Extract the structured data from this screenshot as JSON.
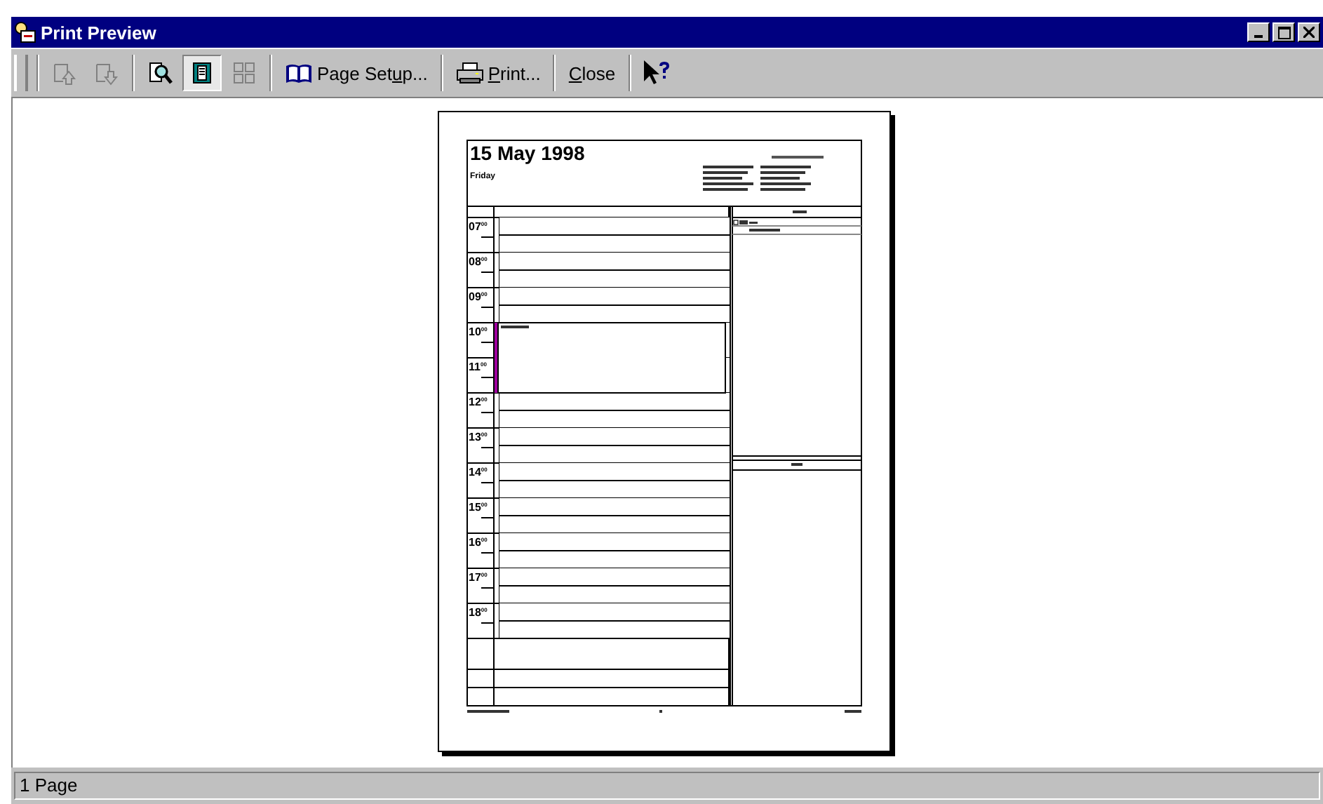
{
  "window": {
    "title": "Print Preview"
  },
  "toolbar": {
    "icon_buttons": [
      {
        "disabled": true,
        "selected": false
      },
      {
        "disabled": true,
        "selected": false
      },
      {
        "disabled": false,
        "selected": false
      },
      {
        "disabled": false,
        "selected": true
      },
      {
        "disabled": true,
        "selected": false
      }
    ],
    "text_buttons": [
      {
        "before": "Page Set",
        "underlined": "u",
        "after": "p..."
      },
      {
        "underlined": "P",
        "after": "rint..."
      },
      {
        "underlined": "C",
        "after": "lose"
      }
    ]
  },
  "page": {
    "date": "15 May 1998",
    "weekday": "Friday",
    "hours": [
      {
        "hour": "07",
        "minutes": "00",
        "booked": false
      },
      {
        "hour": "08",
        "minutes": "00",
        "booked": false
      },
      {
        "hour": "09",
        "minutes": "00",
        "booked": false
      },
      {
        "hour": "10",
        "minutes": "00",
        "booked": true
      },
      {
        "hour": "11",
        "minutes": "00",
        "booked": true
      },
      {
        "hour": "12",
        "minutes": "00",
        "booked": false
      },
      {
        "hour": "13",
        "minutes": "00",
        "booked": false
      },
      {
        "hour": "14",
        "minutes": "00",
        "booked": false
      },
      {
        "hour": "15",
        "minutes": "00",
        "booked": false
      },
      {
        "hour": "16",
        "minutes": "00",
        "booked": false
      },
      {
        "hour": "17",
        "minutes": "00",
        "booked": false
      },
      {
        "hour": "18",
        "minutes": "00",
        "booked": false
      }
    ],
    "appointment": {
      "color": "#a000a0"
    }
  },
  "status_bar": {
    "text": "1 Page"
  }
}
